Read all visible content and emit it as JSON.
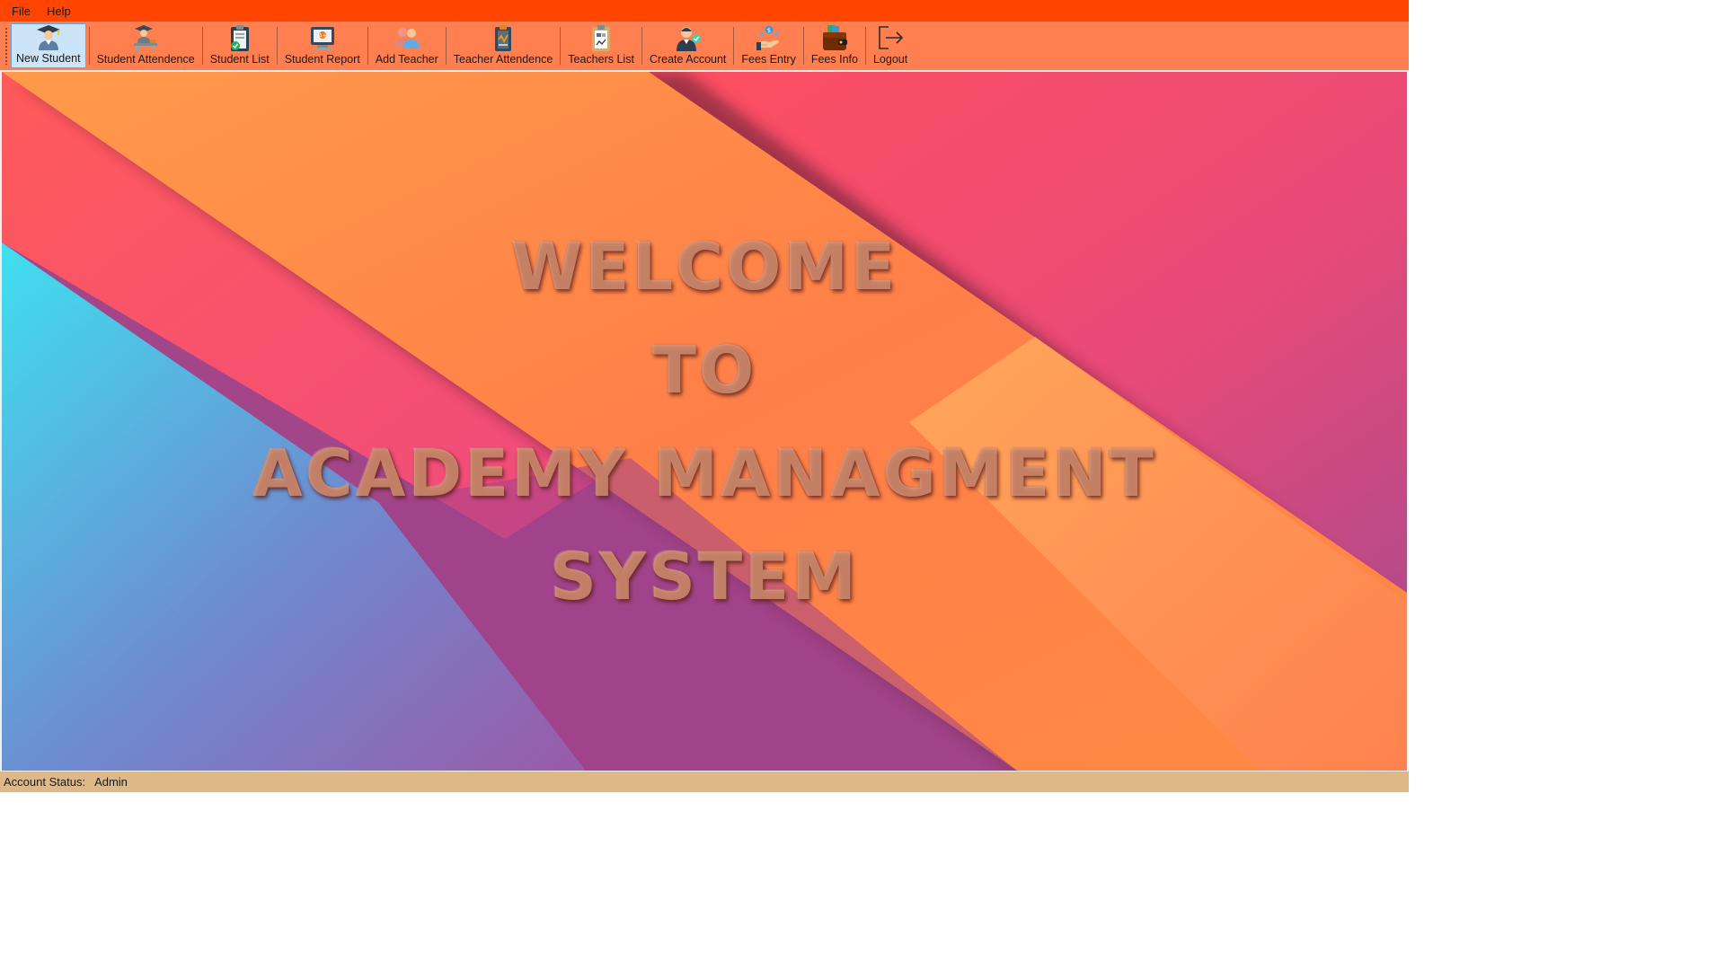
{
  "menu": {
    "file": "File",
    "help": "Help"
  },
  "toolbar": {
    "items": [
      {
        "label": "New Student",
        "icon": "graduate-student-icon",
        "active": true
      },
      {
        "label": "Student Attendence",
        "icon": "student-at-desk-icon"
      },
      {
        "label": "Student List",
        "icon": "clipboard-checklist-icon"
      },
      {
        "label": "Student Report",
        "icon": "report-screen-icon"
      },
      {
        "label": "Add Teacher",
        "icon": "add-people-icon"
      },
      {
        "label": "Teacher Attendence",
        "icon": "attendance-clipboard-icon"
      },
      {
        "label": "Teachers List",
        "icon": "list-clipboard-icon"
      },
      {
        "label": "Create Account",
        "icon": "user-account-icon"
      },
      {
        "label": "Fees Entry",
        "icon": "money-hand-icon"
      },
      {
        "label": "Fees Info",
        "icon": "wallet-icon"
      },
      {
        "label": "Logout",
        "icon": "logout-arrow-icon"
      }
    ]
  },
  "welcome": {
    "line1": "WELCOME",
    "line2": "TO",
    "line3": "ACADEMY MANAGMENT",
    "line4": "SYSTEM"
  },
  "status": {
    "label": "Account Status:",
    "value": "Admin"
  },
  "colors": {
    "menubar": "#ff4500",
    "toolbar": "#ff7f50",
    "statusbar": "#deb887",
    "active_button": "#cce4f7"
  }
}
